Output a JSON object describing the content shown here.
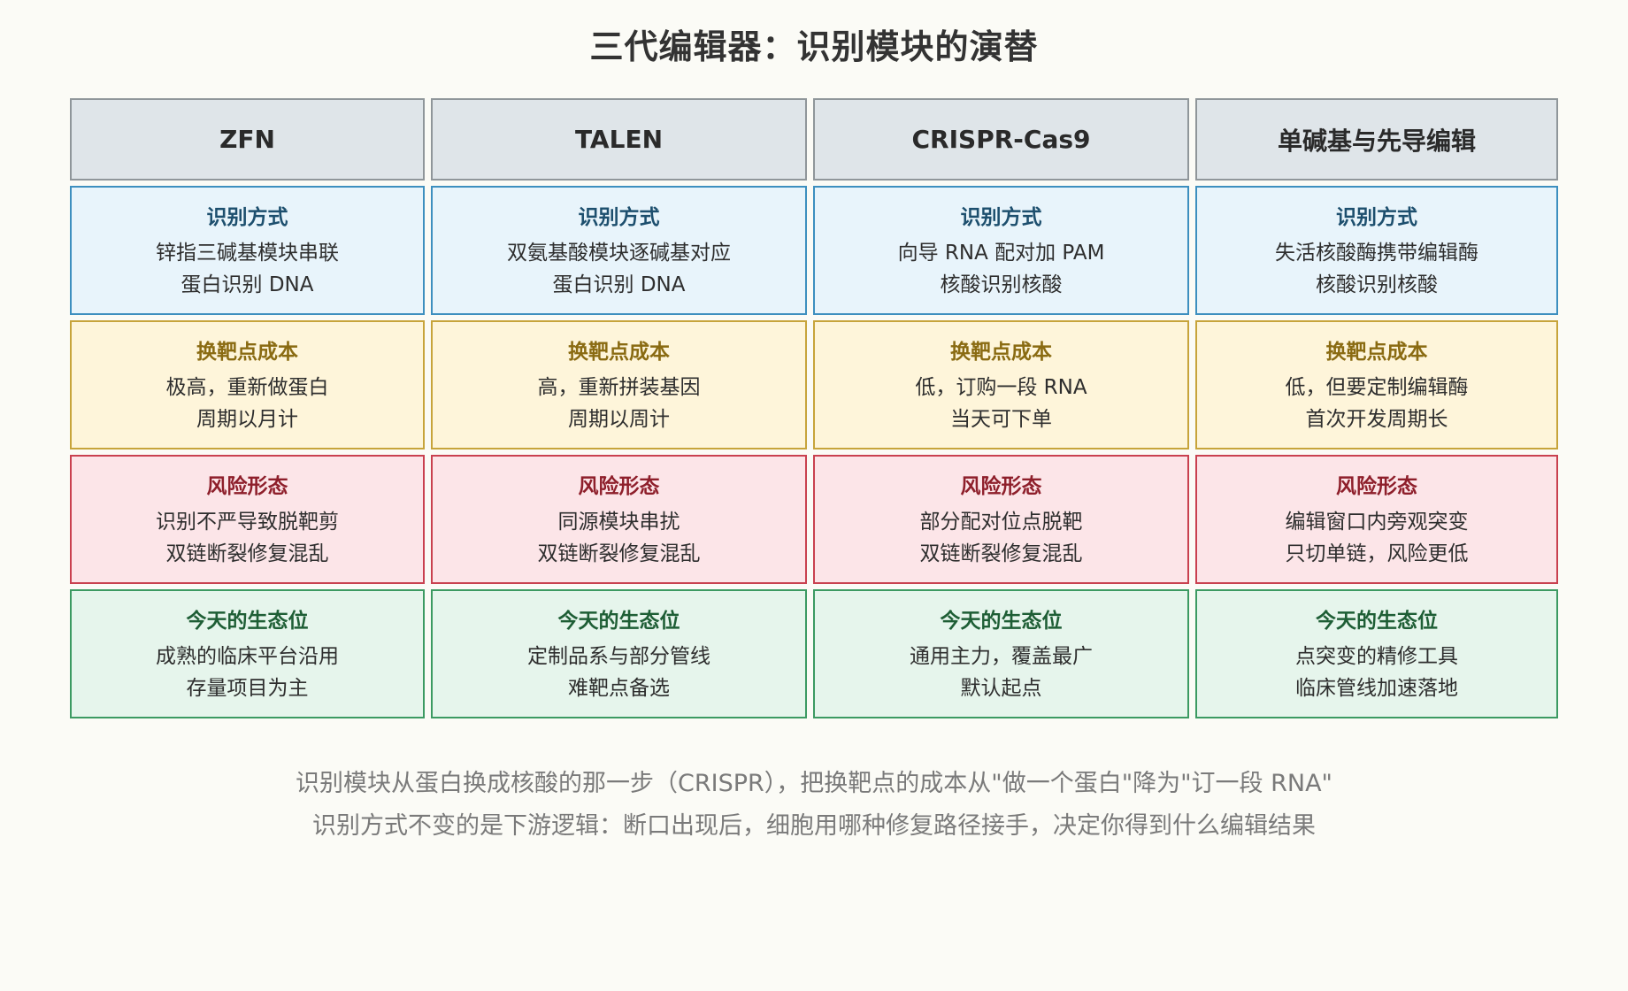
{
  "title": "三代编辑器：识别模块的演替",
  "columns": [
    "ZFN",
    "TALEN",
    "CRISPR-Cas9",
    "单碱基与先导编辑"
  ],
  "rows": [
    {
      "label": "识别方式",
      "cells": [
        [
          "锌指三碱基模块串联",
          "蛋白识别 DNA"
        ],
        [
          "双氨基酸模块逐碱基对应",
          "蛋白识别 DNA"
        ],
        [
          "向导 RNA 配对加 PAM",
          "核酸识别核酸"
        ],
        [
          "失活核酸酶携带编辑酶",
          "核酸识别核酸"
        ]
      ]
    },
    {
      "label": "换靶点成本",
      "cells": [
        [
          "极高，重新做蛋白",
          "周期以月计"
        ],
        [
          "高，重新拼装基因",
          "周期以周计"
        ],
        [
          "低，订购一段 RNA",
          "当天可下单"
        ],
        [
          "低，但要定制编辑酶",
          "首次开发周期长"
        ]
      ]
    },
    {
      "label": "风险形态",
      "cells": [
        [
          "识别不严导致脱靶剪",
          "双链断裂修复混乱"
        ],
        [
          "同源模块串扰",
          "双链断裂修复混乱"
        ],
        [
          "部分配对位点脱靶",
          "双链断裂修复混乱"
        ],
        [
          "编辑窗口内旁观突变",
          "只切单链，风险更低"
        ]
      ]
    },
    {
      "label": "今天的生态位",
      "cells": [
        [
          "成熟的临床平台沿用",
          "存量项目为主"
        ],
        [
          "定制品系与部分管线",
          "难靶点备选"
        ],
        [
          "通用主力，覆盖最广",
          "默认起点"
        ],
        [
          "点突变的精修工具",
          "临床管线加速落地"
        ]
      ]
    }
  ],
  "footer": {
    "line1": "识别模块从蛋白换成核酸的那一步（CRISPR），把换靶点的成本从\"做一个蛋白\"降为\"订一段 RNA\"",
    "line2": "识别方式不变的是下游逻辑：断口出现后，细胞用哪种修复路径接手，决定你得到什么编辑结果"
  }
}
